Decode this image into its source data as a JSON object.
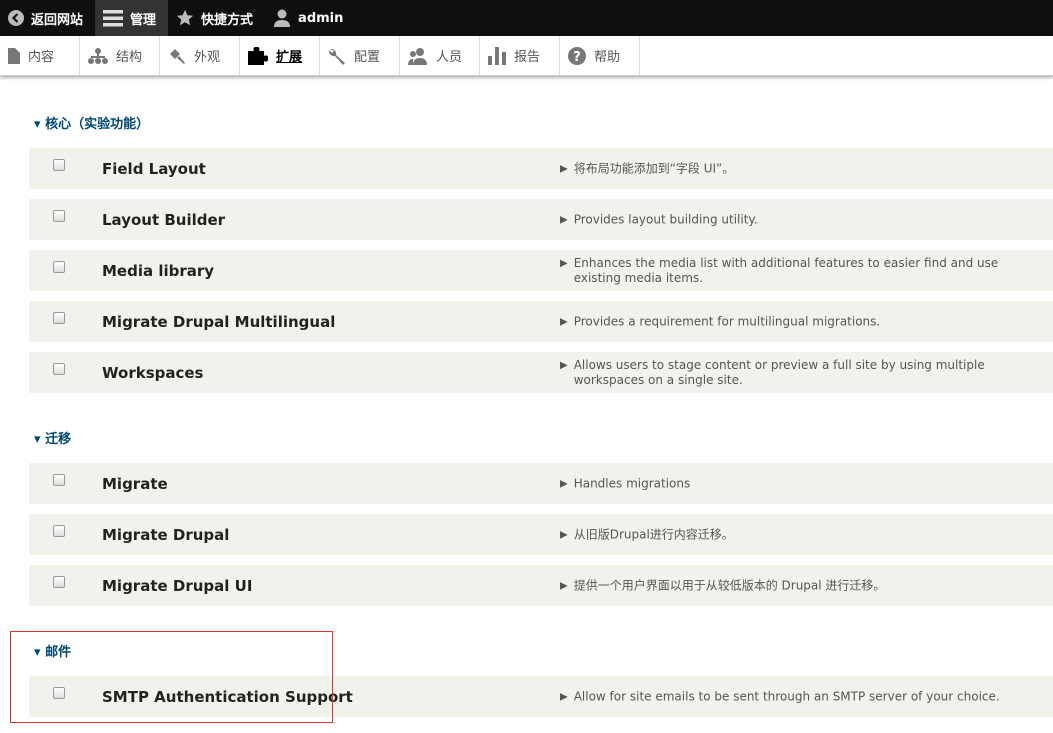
{
  "toolbar": {
    "back": "返回网站",
    "manage": "管理",
    "shortcuts": "快捷方式",
    "user": "admin"
  },
  "tray": [
    "内容",
    "结构",
    "外观",
    "扩展",
    "配置",
    "人员",
    "报告",
    "帮助"
  ],
  "sections": [
    {
      "title": "核心（实验功能）",
      "modules": [
        {
          "name": "Field Layout",
          "desc": "将布局功能添加到“字段 UI”。"
        },
        {
          "name": "Layout Builder",
          "desc": "Provides layout building utility."
        },
        {
          "name": "Media library",
          "desc": "Enhances the media list with additional features to easier find and use existing media items."
        },
        {
          "name": "Migrate Drupal Multilingual",
          "desc": "Provides a requirement for multilingual migrations."
        },
        {
          "name": "Workspaces",
          "desc": "Allows users to stage content or preview a full site by using multiple workspaces on a single site."
        }
      ]
    },
    {
      "title": "迁移",
      "modules": [
        {
          "name": "Migrate",
          "desc": "Handles migrations"
        },
        {
          "name": "Migrate Drupal",
          "desc": "从旧版Drupal进行内容迁移。"
        },
        {
          "name": "Migrate Drupal UI",
          "desc": "提供一个用户界面以用于从较低版本的 Drupal 进行迁移。"
        }
      ]
    },
    {
      "title": "邮件",
      "modules": [
        {
          "name": "SMTP Authentication Support",
          "desc": "Allow for site emails to be sent through an SMTP server of your choice."
        }
      ]
    }
  ]
}
